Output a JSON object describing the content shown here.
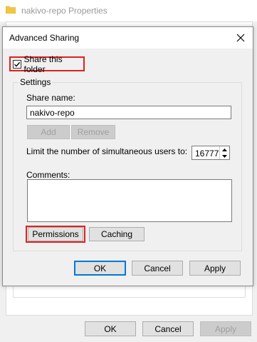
{
  "background": {
    "title": "nakivo-repo Properties",
    "buttons": {
      "ok": "OK",
      "cancel": "Cancel",
      "apply": "Apply"
    }
  },
  "dialog": {
    "title": "Advanced Sharing",
    "share_checkbox": {
      "label": "Share this folder",
      "checked": true
    },
    "settings": {
      "group_label": "Settings",
      "share_name_label": "Share name:",
      "share_name_value": "nakivo-repo",
      "add_label": "Add",
      "remove_label": "Remove",
      "limit_label": "Limit the number of simultaneous users to:",
      "limit_value": "16777",
      "comments_label": "Comments:",
      "comments_value": "",
      "permissions_label": "Permissions",
      "caching_label": "Caching"
    },
    "buttons": {
      "ok": "OK",
      "cancel": "Cancel",
      "apply": "Apply"
    }
  },
  "colors": {
    "highlight": "#e02020",
    "accent": "#0078d7"
  }
}
